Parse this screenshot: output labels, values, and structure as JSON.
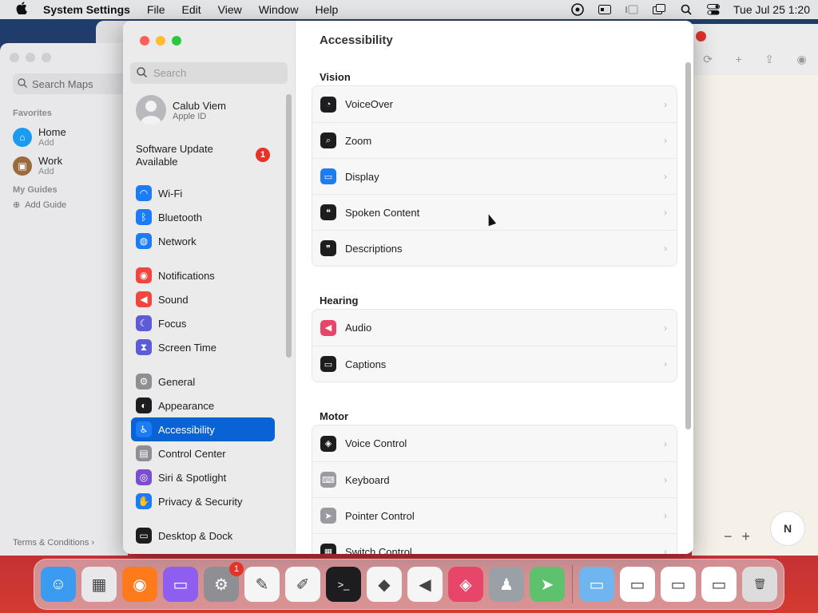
{
  "menubar": {
    "app": "System Settings",
    "items": [
      "File",
      "Edit",
      "View",
      "Window",
      "Help"
    ],
    "clock": "Tue Jul 25  1:20"
  },
  "maps": {
    "search_placeholder": "Search Maps",
    "favorites_header": "Favorites",
    "favorites": [
      {
        "title": "Home",
        "sub": "Add",
        "color": "#1a9af0"
      },
      {
        "title": "Work",
        "sub": "Add",
        "color": "#9a6b3e"
      }
    ],
    "guides_header": "My Guides",
    "add_guide": "Add Guide",
    "terms": "Terms & Conditions"
  },
  "settings": {
    "search_placeholder": "Search",
    "user": {
      "name": "Calub Viem",
      "sub": "Apple ID"
    },
    "update": {
      "label": "Software Update Available",
      "badge": "1"
    },
    "sidebar": [
      {
        "label": "Wi-Fi",
        "icon": "wifi-icon",
        "color": "#1b7cf5",
        "glyph": "◠"
      },
      {
        "label": "Bluetooth",
        "icon": "bluetooth-icon",
        "color": "#1b7cf5",
        "glyph": "ᛒ"
      },
      {
        "label": "Network",
        "icon": "network-icon",
        "color": "#1b7cf5",
        "glyph": "◍"
      },
      {
        "label": "Notifications",
        "icon": "notifications-icon",
        "color": "#f1453d",
        "glyph": "◉"
      },
      {
        "label": "Sound",
        "icon": "sound-icon",
        "color": "#f1453d",
        "glyph": "◀"
      },
      {
        "label": "Focus",
        "icon": "focus-icon",
        "color": "#5d5bd6",
        "glyph": "☾"
      },
      {
        "label": "Screen Time",
        "icon": "screen-time-icon",
        "color": "#5d5bd6",
        "glyph": "⧗"
      },
      {
        "label": "General",
        "icon": "general-icon",
        "color": "#8e8e93",
        "glyph": "⚙"
      },
      {
        "label": "Appearance",
        "icon": "appearance-icon",
        "color": "#1d1d1f",
        "glyph": "◐"
      },
      {
        "label": "Accessibility",
        "icon": "accessibility-icon",
        "color": "#1b7cf5",
        "glyph": "♿"
      },
      {
        "label": "Control Center",
        "icon": "control-center-icon",
        "color": "#8e8e93",
        "glyph": "▤"
      },
      {
        "label": "Siri & Spotlight",
        "icon": "siri-icon",
        "color": "#7a4fd1",
        "glyph": "◎"
      },
      {
        "label": "Privacy & Security",
        "icon": "privacy-icon",
        "color": "#1b7cf5",
        "glyph": "✋"
      },
      {
        "label": "Desktop & Dock",
        "icon": "desktop-dock-icon",
        "color": "#1d1d1f",
        "glyph": "▭"
      }
    ],
    "selected": "Accessibility",
    "content": {
      "title": "Accessibility",
      "sections": [
        {
          "header": "Vision",
          "rows": [
            {
              "label": "VoiceOver",
              "icon": "voiceover-icon",
              "glyph": "◔"
            },
            {
              "label": "Zoom",
              "icon": "zoom-icon",
              "glyph": "⌕"
            },
            {
              "label": "Display",
              "icon": "display-icon",
              "glyph": "▭"
            },
            {
              "label": "Spoken Content",
              "icon": "spoken-content-icon",
              "glyph": "❝"
            },
            {
              "label": "Descriptions",
              "icon": "descriptions-icon",
              "glyph": "❞"
            }
          ]
        },
        {
          "header": "Hearing",
          "rows": [
            {
              "label": "Audio",
              "icon": "audio-icon",
              "glyph": "◀"
            },
            {
              "label": "Captions",
              "icon": "captions-icon",
              "glyph": "▭"
            }
          ]
        },
        {
          "header": "Motor",
          "rows": [
            {
              "label": "Voice Control",
              "icon": "voice-control-icon",
              "glyph": "◈"
            },
            {
              "label": "Keyboard",
              "icon": "keyboard-icon",
              "glyph": "⌨"
            },
            {
              "label": "Pointer Control",
              "icon": "pointer-control-icon",
              "glyph": "➤"
            },
            {
              "label": "Switch Control",
              "icon": "switch-control-icon",
              "glyph": "▦"
            }
          ]
        }
      ]
    }
  },
  "dock": {
    "apps": [
      {
        "name": "finder-icon",
        "color": "#3a9bf0",
        "glyph": "☺"
      },
      {
        "name": "launchpad-icon",
        "color": "#e8e8ea",
        "glyph": "▦"
      },
      {
        "name": "firefox-icon",
        "color": "#ff7a1a",
        "glyph": "◉"
      },
      {
        "name": "podcasts-icon",
        "color": "#8d5ef0",
        "glyph": "▭"
      },
      {
        "name": "system-settings-icon",
        "color": "#8e8e93",
        "glyph": "⚙",
        "badge": "1"
      },
      {
        "name": "freeform-icon",
        "color": "#f5f5f5",
        "glyph": "✎"
      },
      {
        "name": "textedit-icon",
        "color": "#f5f5f5",
        "glyph": "✐"
      },
      {
        "name": "terminal-icon",
        "color": "#1d1d1f",
        "glyph": ">_"
      },
      {
        "name": "visual-studio-icon",
        "color": "#f5f5f5",
        "glyph": "◆"
      },
      {
        "name": "vscode-icon",
        "color": "#f5f5f5",
        "glyph": "◀"
      },
      {
        "name": "shortcuts-icon",
        "color": "#e8456b",
        "glyph": "◈"
      },
      {
        "name": "automator-icon",
        "color": "#9aa0a6",
        "glyph": "♟"
      },
      {
        "name": "maps-icon",
        "color": "#5dc16d",
        "glyph": "➤"
      }
    ],
    "others": [
      {
        "name": "downloads-folder-icon",
        "color": "#6fb6f0",
        "glyph": "▭"
      },
      {
        "name": "window-thumb-1-icon",
        "color": "#ffffff",
        "glyph": "▭"
      },
      {
        "name": "window-thumb-2-icon",
        "color": "#ffffff",
        "glyph": "▭"
      },
      {
        "name": "window-thumb-3-icon",
        "color": "#ffffff",
        "glyph": "▭"
      },
      {
        "name": "trash-icon",
        "color": "#dcdcdc",
        "glyph": "🗑"
      }
    ]
  }
}
